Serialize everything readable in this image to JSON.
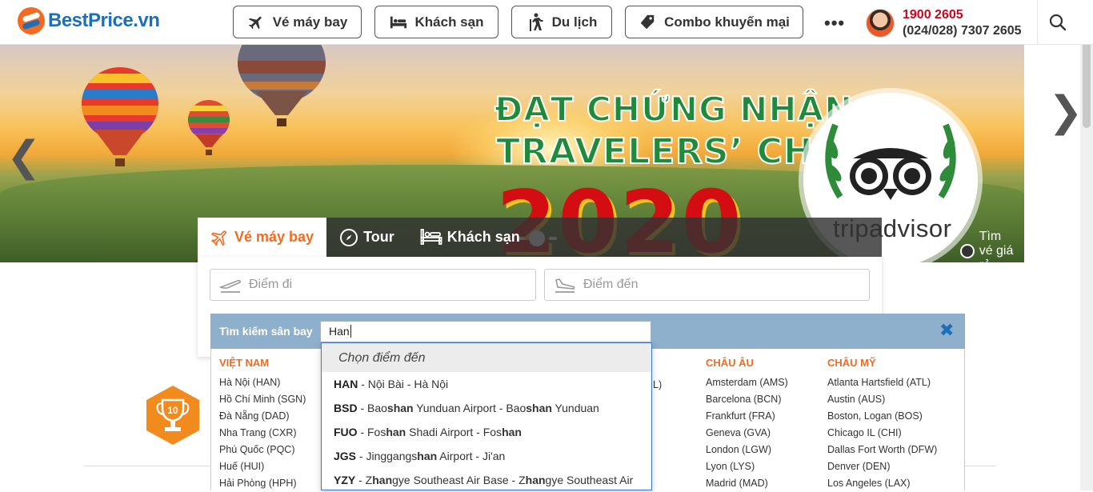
{
  "header": {
    "logo_name": "BestPrice",
    "logo_tld": ".vn",
    "nav": [
      {
        "label": "Vé máy bay",
        "icon": "plane-icon"
      },
      {
        "label": "Khách sạn",
        "icon": "bed-icon"
      },
      {
        "label": "Du lịch",
        "icon": "hiker-icon"
      },
      {
        "label": "Combo khuyến mại",
        "icon": "tag-icon"
      }
    ],
    "more": "•••",
    "hotline": "1900 2605",
    "phone": "(024/028) 7307 2605"
  },
  "banner": {
    "line1": "ĐẠT CHỨNG NHẬN",
    "line2": "TRAVELERS’ CHOICE",
    "year": "2020",
    "brand": "tripadvisor",
    "prev": "❮",
    "next": "❯"
  },
  "search": {
    "tabs": [
      "Vé máy bay",
      "Tour",
      "Khách sạn"
    ],
    "cheap_toggle": "Tìm vé giá rẻ",
    "from_placeholder": "Điểm đi",
    "to_placeholder": "Điểm đến"
  },
  "airport_search": {
    "label": "Tìm kiếm sân bay",
    "value": "Han",
    "close": "✖",
    "columns": [
      {
        "title": "VIỆT NAM",
        "items": [
          "Hà Nội (HAN)",
          "Hồ Chí Minh (SGN)",
          "Đà Nẵng (DAD)",
          "Nha Trang (CXR)",
          "Phú Quốc (PQC)",
          "Huế (HUI)",
          "Hải Phòng (HPH)"
        ]
      },
      {
        "title": "CHÂU ÂU",
        "items": [
          "Amsterdam (AMS)",
          "Barcelona (BCN)",
          "Frankfurt (FRA)",
          "Geneva (GVA)",
          "London (LGW)",
          "Lyon (LYS)",
          "Madrid (MAD)"
        ]
      },
      {
        "title": "CHÂU MỸ",
        "items": [
          "Atlanta Hartsfield (ATL)",
          "Austin (AUS)",
          "Boston, Logan (BOS)",
          "Chicago IL (CHI)",
          "Dallas Fort Worth (DFW)",
          "Denver (DEN)",
          "Los Angeles (LAX)"
        ]
      }
    ],
    "hidden_fragment": "L)"
  },
  "suggestions": {
    "header": "Chọn điểm đến",
    "items": [
      {
        "code": "HAN",
        "parts": [
          " - Nội Bài - Hà Nội"
        ]
      },
      {
        "code": "BSD",
        "parts": [
          " - Bao",
          "shan",
          " Yunduan Airport - Bao",
          "shan",
          " Yunduan"
        ]
      },
      {
        "code": "FUO",
        "parts": [
          " - Fos",
          "han",
          " Shadi Airport - Fos",
          "han"
        ]
      },
      {
        "code": "JGS",
        "parts": [
          " - Jinggangs",
          "han",
          " Airport - Ji'an"
        ]
      },
      {
        "code": "YZY",
        "parts": [
          " - Z",
          "han",
          "gye Southeast Air Base - Z",
          "han",
          "gye Southeast Air"
        ]
      }
    ]
  },
  "colors": {
    "brand_blue": "#1c6fb8",
    "brand_orange": "#f26b21",
    "hotline_red": "#d0021b",
    "airport_bar": "#8fb0cc"
  }
}
